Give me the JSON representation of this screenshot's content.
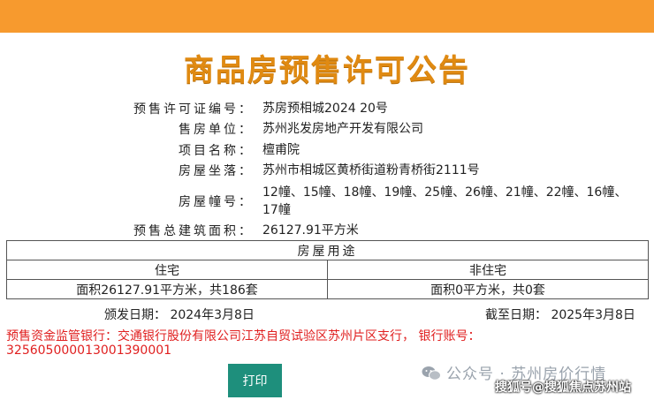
{
  "title": "商品房预售许可公告",
  "fields": [
    {
      "label": "预售许可证编号：",
      "value": "苏房预相城2024 20号"
    },
    {
      "label": "售房单位：",
      "value": "苏州兆发房地产开发有限公司"
    },
    {
      "label": "项目名称：",
      "value": "檀甫院"
    },
    {
      "label": "房屋坐落：",
      "value": "苏州市相城区黄桥街道粉青桥街2111号"
    },
    {
      "label": "房屋幢号：",
      "value": "12幢、15幢、18幢、19幢、25幢、26幢、21幢、22幢、16幢、17幢"
    },
    {
      "label": "预售总建筑面积：",
      "value": "26127.91平方米"
    }
  ],
  "usage_table": {
    "header": "房屋用途",
    "col1_label": "住宅",
    "col2_label": "非住宅",
    "col1_value": "面积26127.91平方米，共186套",
    "col2_value": "面积0平方米，共0套"
  },
  "issue_date": "颁发日期：  2024年3月8日",
  "expiry_date": "截至日期：  2025年3月8日",
  "bank_line1": "预售资金监管银行：交通银行股份有限公司江苏自贸试验区苏州片区支行，  银行账号：",
  "bank_account": "325605000013001390001",
  "print_button": "打印",
  "watermark": "公众号 · 苏州房价行情",
  "watermark2": "搜狐号@搜狐焦点苏州站",
  "colors": {
    "topbar": "#f79a2e",
    "title": "#e08a12",
    "alert": "#e02020",
    "button": "#1e8f7c"
  }
}
